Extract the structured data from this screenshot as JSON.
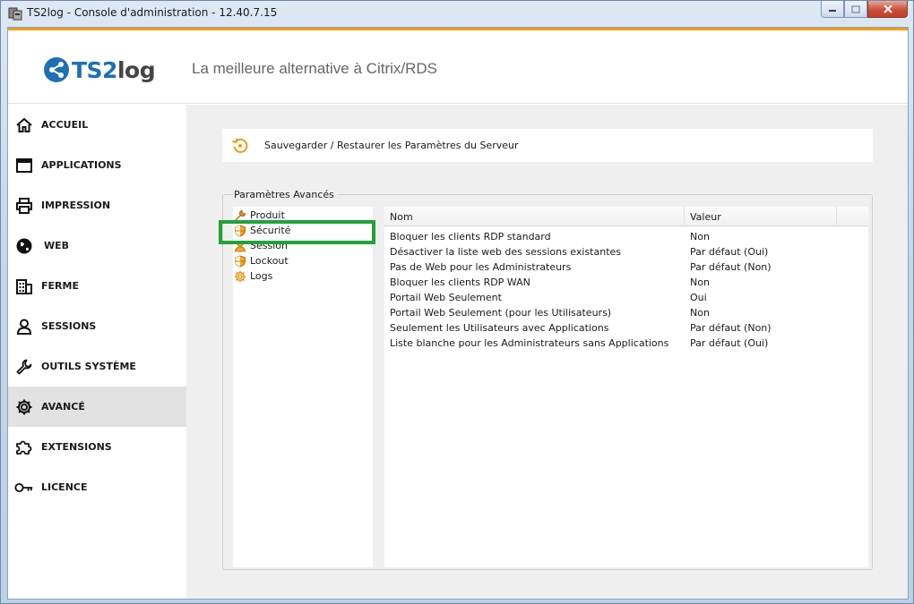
{
  "window": {
    "title": "TS2log - Console d'administration - 12.40.7.15"
  },
  "header": {
    "logo_ts": "TS2",
    "logo_log": "log",
    "tagline": "La meilleure alternative à Citrix/RDS"
  },
  "sidebar": {
    "items": [
      {
        "label": "ACCUEIL",
        "icon": "home-icon"
      },
      {
        "label": "APPLICATIONS",
        "icon": "window-icon"
      },
      {
        "label": "IMPRESSION",
        "icon": "printer-icon"
      },
      {
        "label": "WEB",
        "icon": "globe-icon"
      },
      {
        "label": "FERME",
        "icon": "building-icon"
      },
      {
        "label": "SESSIONS",
        "icon": "user-icon"
      },
      {
        "label": "OUTILS SYSTÈME",
        "icon": "wrench-icon"
      },
      {
        "label": "AVANCÉ",
        "icon": "gear-icon",
        "active": true
      },
      {
        "label": "EXTENSIONS",
        "icon": "puzzle-icon"
      },
      {
        "label": "LICENCE",
        "icon": "key-icon"
      }
    ]
  },
  "main": {
    "save_restore_label": "Sauvegarder / Restaurer les Paramètres du Serveur",
    "group_label": "Paramètres Avancés",
    "tree": [
      {
        "label": "Produit",
        "icon": "tools-icon"
      },
      {
        "label": "Sécurité",
        "icon": "shield-icon",
        "selected": true
      },
      {
        "label": "Session",
        "icon": "session-icon"
      },
      {
        "label": "Lockout",
        "icon": "shield-icon"
      },
      {
        "label": "Logs",
        "icon": "gear-icon"
      }
    ],
    "table": {
      "columns": [
        "Nom",
        "Valeur"
      ],
      "rows": [
        {
          "name": "Bloquer les clients RDP standard",
          "value": "Non"
        },
        {
          "name": "Désactiver la liste web des sessions existantes",
          "value": "Par défaut (Oui)"
        },
        {
          "name": "Pas de Web pour les Administrateurs",
          "value": "Par défaut (Non)"
        },
        {
          "name": "Bloquer les clients RDP WAN",
          "value": "Non"
        },
        {
          "name": "Portail Web Seulement",
          "value": "Oui"
        },
        {
          "name": "Portail Web Seulement (pour les Utilisateurs)",
          "value": "Non"
        },
        {
          "name": "Seulement les Utilisateurs avec Applications",
          "value": "Par défaut (Non)"
        },
        {
          "name": "Liste blanche pour les Administrateurs sans Applications",
          "value": "Par défaut (Oui)"
        }
      ]
    }
  },
  "colors": {
    "accent_orange": "#f39c12",
    "brand_blue": "#1f6fb4",
    "highlight_green": "#1fa33a",
    "active_nav_bg": "#e2e2e2"
  }
}
